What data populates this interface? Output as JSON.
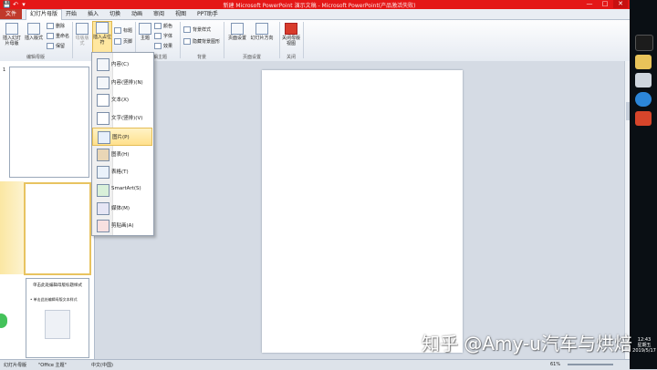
{
  "window": {
    "title": "新建 Microsoft PowerPoint 演示文稿 - Microsoft PowerPoint(产品激活失败)",
    "controls": {
      "minimize": "—",
      "maximize": "□",
      "close": "✕"
    },
    "quick_access": [
      "💾",
      "↶",
      "▾"
    ]
  },
  "tabs": {
    "file": "文件",
    "items": [
      "幻灯片母版",
      "开始",
      "插入",
      "切换",
      "动画",
      "审阅",
      "视图",
      "PPT助手"
    ]
  },
  "ribbon": {
    "insert_slide_master": "插入幻灯片母版",
    "insert_layout": "插入版式",
    "delete": "删除",
    "rename": "重命名",
    "preserve": "保留",
    "master_layout": "母版版式",
    "insert_placeholder": "插入占位符",
    "title_check": "标题",
    "footer_check": "页脚",
    "theme": "主题",
    "colors": "颜色",
    "fonts": "字体",
    "effects": "效果",
    "background_styles": "背景样式",
    "hide_bg_graphics": "隐藏背景图形",
    "page_setup": "页面设置",
    "slide_orientation": "幻灯片方向",
    "close_master_view": "关闭母版视图",
    "groups": {
      "edit_master": "编辑母版",
      "edit_theme": "编辑主题",
      "background": "背景",
      "page_setup": "页面设置",
      "close": "关闭"
    }
  },
  "placeholder_menu": {
    "items": [
      {
        "label": "内容(C)",
        "icon": "content-icon",
        "highlighted": false
      },
      {
        "label": "内容(竖排)(N)",
        "icon": "content-vertical-icon",
        "highlighted": false
      },
      {
        "label": "文本(X)",
        "icon": "text-icon",
        "highlighted": false
      },
      {
        "label": "文字(竖排)(V)",
        "icon": "text-vertical-icon",
        "highlighted": false
      },
      {
        "label": "图片(P)",
        "icon": "picture-icon",
        "highlighted": true
      },
      {
        "label": "图表(H)",
        "icon": "chart-icon",
        "highlighted": false
      },
      {
        "label": "表格(T)",
        "icon": "table-icon",
        "highlighted": false
      },
      {
        "label": "SmartArt(S)",
        "icon": "smartart-icon",
        "highlighted": false
      },
      {
        "label": "媒体(M)",
        "icon": "media-icon",
        "highlighted": false
      },
      {
        "label": "剪贴画(A)",
        "icon": "clipart-icon",
        "highlighted": false
      }
    ]
  },
  "thumbnails": {
    "slide1_number": "1",
    "thumb3_title": "单击此处编辑母版标题样式",
    "thumb3_body": "• 单击此处编辑母版文本样式"
  },
  "statusbar": {
    "view": "幻灯片母版",
    "theme": "\"Office 主题\"",
    "language": "中文(中国)",
    "zoom": "61%"
  },
  "taskbar": {
    "time": "12:43",
    "weekday": "星期五",
    "date": "2019/5/17"
  },
  "watermark": "知乎 @Amy-u汽车与烘焙",
  "colors": {
    "titlebar": "#e41717",
    "file_tab": "#c0392b",
    "highlight": "#ffe08c"
  }
}
